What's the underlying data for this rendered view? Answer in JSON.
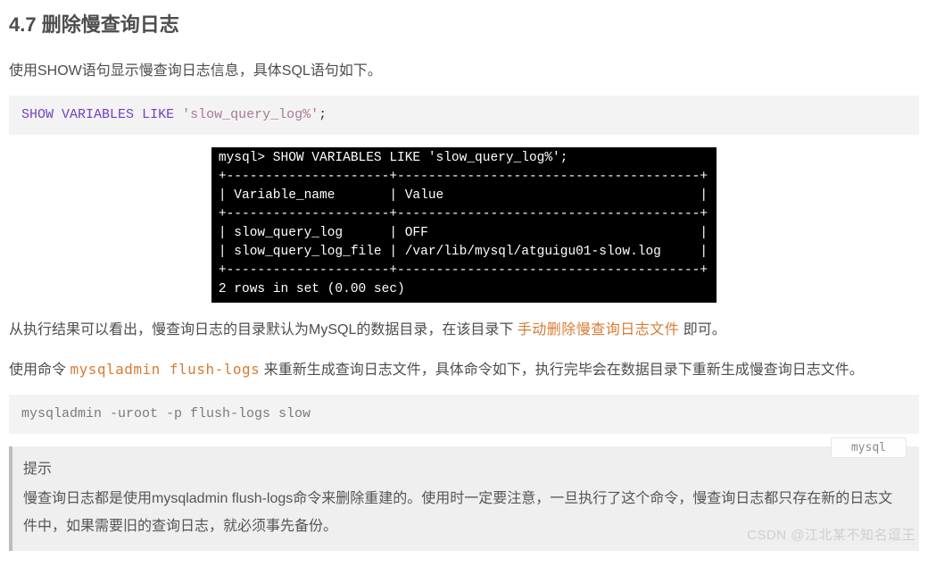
{
  "heading": "4.7 删除慢查询日志",
  "p1": "使用SHOW语句显示慢查询日志信息，具体SQL语句如下。",
  "code1": {
    "kw1": "SHOW",
    "kw2": "VARIABLES",
    "kw3": "LIKE",
    "str": "'slow_query_log%'",
    "end": ";"
  },
  "terminal": "mysql> SHOW VARIABLES LIKE 'slow_query_log%';\n+---------------------+---------------------------------------+\n| Variable_name       | Value                                 |\n+---------------------+---------------------------------------+\n| slow_query_log      | OFF                                   |\n| slow_query_log_file | /var/lib/mysql/atguigu01-slow.log     |\n+---------------------+---------------------------------------+\n2 rows in set (0.00 sec)",
  "p2a": "从执行结果可以看出，慢查询日志的目录默认为MySQL的数据目录，在该目录下 ",
  "p2_inline": "手动删除慢查询日志文件",
  "p2b": " 即可。",
  "p3a": "使用命令 ",
  "p3_inline": "mysqladmin flush-logs",
  "p3b": " 来重新生成查询日志文件，具体命令如下，执行完毕会在数据目录下重新生成慢查询日志文件。",
  "code2": "mysqladmin -uroot -p flush-logs slow",
  "badge": "mysql",
  "tip_title": "提示",
  "tip_body": "慢查询日志都是使用mysqladmin flush-logs命令来删除重建的。使用时一定要注意，一旦执行了这个命令，慢查询日志都只存在新的日志文件中，如果需要旧的查询日志，就必须事先备份。",
  "watermark": "CSDN @江北某不知名逗王"
}
